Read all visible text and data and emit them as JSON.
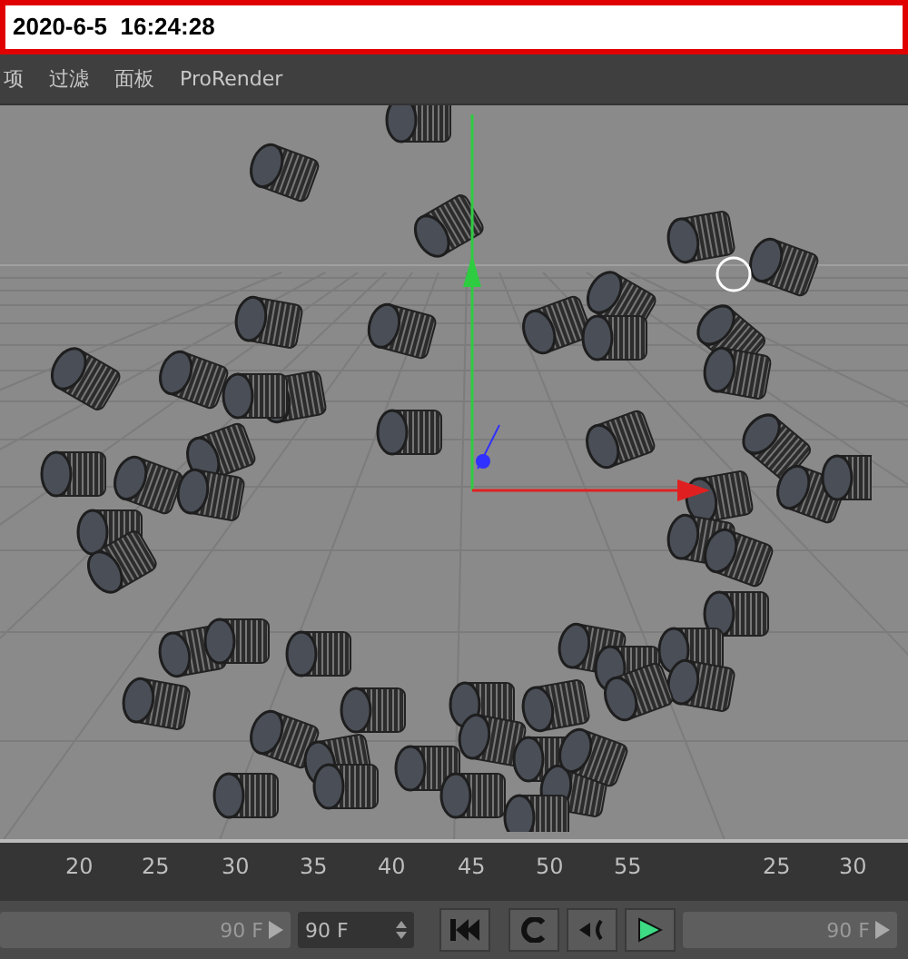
{
  "timestamp": "2020-6-5  16:24:28",
  "menu": [
    "项",
    "过滤",
    "面板",
    "ProRender"
  ],
  "ruler": {
    "labels": [
      "20",
      "25",
      "30",
      "35",
      "40",
      "45",
      "50",
      "55",
      "25",
      "30"
    ]
  },
  "controls": {
    "end_slider": "90 F",
    "end_field": "90 F",
    "right_slider": "90 F"
  }
}
